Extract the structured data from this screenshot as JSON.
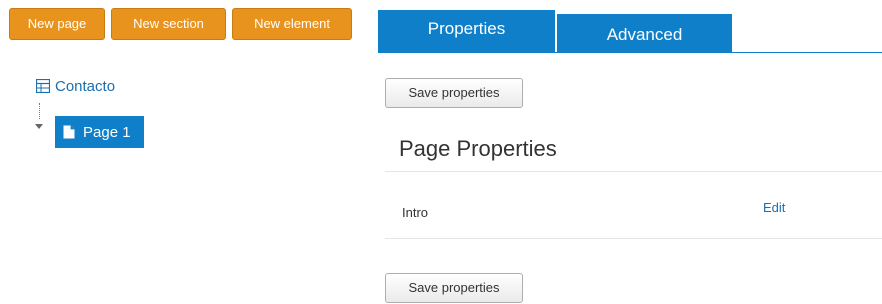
{
  "toolbar": {
    "new_page": "New page",
    "new_section": "New section",
    "new_element": "New element"
  },
  "tree": {
    "root_label": "Contacto",
    "root_icon": "grid-table-icon",
    "children": [
      {
        "label": "Page 1",
        "icon": "page-icon",
        "selected": true
      }
    ]
  },
  "tabs": [
    {
      "label": "Properties",
      "active": true
    },
    {
      "label": "Advanced",
      "active": false
    }
  ],
  "panel": {
    "save_label": "Save properties",
    "section_title": "Page Properties",
    "properties": [
      {
        "label": "Intro",
        "action": "Edit"
      }
    ]
  },
  "colors": {
    "toolbar_button": "#e8931e",
    "tab": "#0f7fc9",
    "selected_node": "#0f7fc9",
    "link": "#1a6fb0"
  }
}
